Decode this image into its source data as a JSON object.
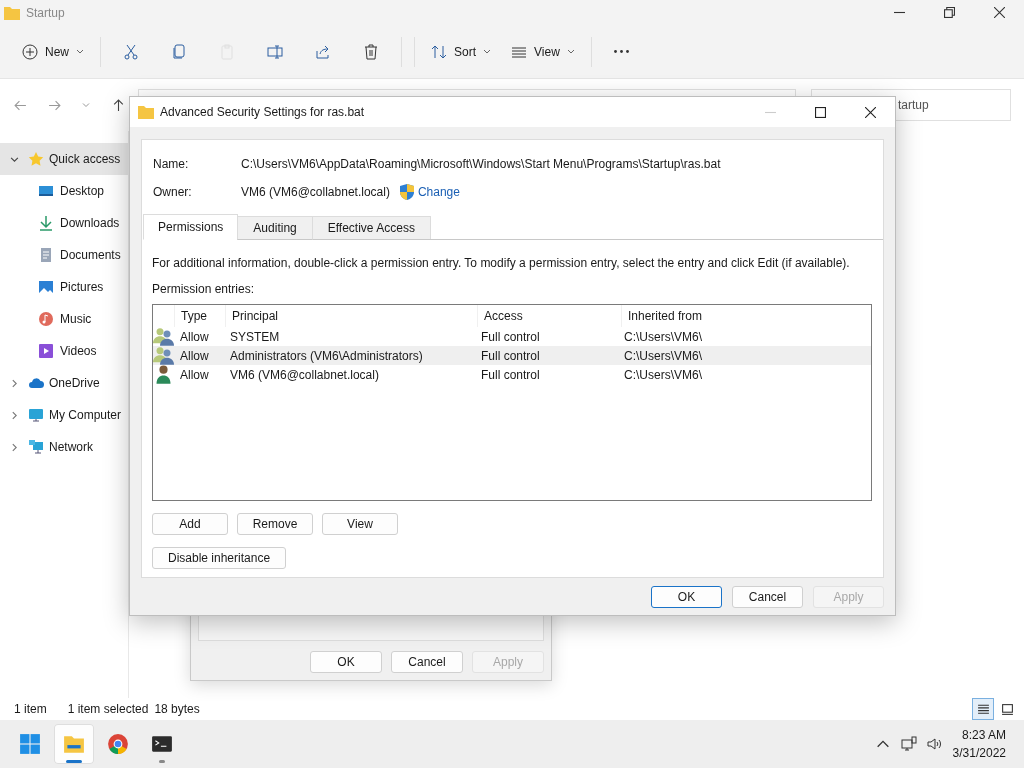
{
  "explorer": {
    "title": "Startup",
    "toolbar": [
      {
        "kind": "new",
        "label": "New",
        "disabled": false
      },
      {
        "kind": "cut",
        "disabled": false
      },
      {
        "kind": "copy",
        "disabled": false
      },
      {
        "kind": "paste",
        "disabled": true
      },
      {
        "kind": "rename",
        "disabled": false
      },
      {
        "kind": "share",
        "disabled": false
      },
      {
        "kind": "delete",
        "disabled": false
      },
      {
        "kind": "sort",
        "label": "Sort",
        "disabled": false
      },
      {
        "kind": "view",
        "label": "View",
        "disabled": false
      },
      {
        "kind": "more",
        "disabled": false
      }
    ],
    "search": {
      "placeholder": "tartup"
    },
    "nav": [
      {
        "label": "Quick access",
        "kind": "star",
        "expanded": true,
        "selected": true,
        "children": [
          {
            "label": "Desktop",
            "kind": "desktop",
            "selected": false
          },
          {
            "label": "Downloads",
            "kind": "download",
            "selected": false
          },
          {
            "label": "Documents",
            "kind": "document",
            "selected": false
          },
          {
            "label": "Pictures",
            "kind": "pictures",
            "selected": false
          },
          {
            "label": "Music",
            "kind": "music",
            "selected": false
          },
          {
            "label": "Videos",
            "kind": "videos",
            "selected": false
          }
        ]
      },
      {
        "label": "OneDrive",
        "kind": "cloud",
        "expanded": false,
        "selected": false
      },
      {
        "label": "My Computer",
        "kind": "computer",
        "expanded": false,
        "selected": false
      },
      {
        "label": "Network",
        "kind": "network",
        "expanded": false,
        "selected": false
      }
    ],
    "status": [
      "1 item",
      "1 item selected",
      "18 bytes"
    ],
    "view_modes": [
      {
        "kind": "details",
        "selected": true
      },
      {
        "kind": "tiles",
        "selected": false
      }
    ]
  },
  "back_dialog": {
    "buttons": [
      {
        "label": "OK",
        "disabled": false
      },
      {
        "label": "Cancel",
        "disabled": false
      },
      {
        "label": "Apply",
        "disabled": true
      }
    ]
  },
  "dialog": {
    "title": "Advanced Security Settings for ras.bat",
    "name_label": "Name:",
    "name_value": "C:\\Users\\VM6\\AppData\\Roaming\\Microsoft\\Windows\\Start Menu\\Programs\\Startup\\ras.bat",
    "owner_label": "Owner:",
    "owner_value": "VM6 (VM6@collabnet.local)",
    "change_link": "Change",
    "tabs": [
      {
        "label": "Permissions",
        "selected": true
      },
      {
        "label": "Auditing",
        "selected": false
      },
      {
        "label": "Effective Access",
        "selected": false
      }
    ],
    "info": "For additional information, double-click a permission entry. To modify a permission entry, select the entry and click Edit (if available).",
    "entries_label": "Permission entries:",
    "columns": [
      "Type",
      "Principal",
      "Access",
      "Inherited from"
    ],
    "rows": [
      {
        "kind": "group",
        "type": "Allow",
        "principal": "SYSTEM",
        "access": "Full control",
        "inherited": "C:\\Users\\VM6\\",
        "highlighted": false
      },
      {
        "kind": "group",
        "type": "Allow",
        "principal": "Administrators (VM6\\Administrators)",
        "access": "Full control",
        "inherited": "C:\\Users\\VM6\\",
        "highlighted": true
      },
      {
        "kind": "user",
        "type": "Allow",
        "principal": "VM6 (VM6@collabnet.local)",
        "access": "Full control",
        "inherited": "C:\\Users\\VM6\\",
        "highlighted": false
      }
    ],
    "list_buttons": [
      "Add",
      "Remove",
      "View"
    ],
    "inheritance_button": "Disable inheritance",
    "footer_buttons": [
      {
        "label": "OK",
        "default": true,
        "disabled": false
      },
      {
        "label": "Cancel",
        "default": false,
        "disabled": false
      },
      {
        "label": "Apply",
        "default": false,
        "disabled": true
      }
    ]
  },
  "taskbar": {
    "apps": [
      {
        "kind": "start",
        "active": false,
        "running": false
      },
      {
        "kind": "explorer",
        "active": true,
        "running": true
      },
      {
        "kind": "chrome",
        "active": false,
        "running": false
      },
      {
        "kind": "terminal",
        "active": false,
        "running": true
      }
    ],
    "time": "8:23 AM",
    "date": "3/31/2022"
  }
}
